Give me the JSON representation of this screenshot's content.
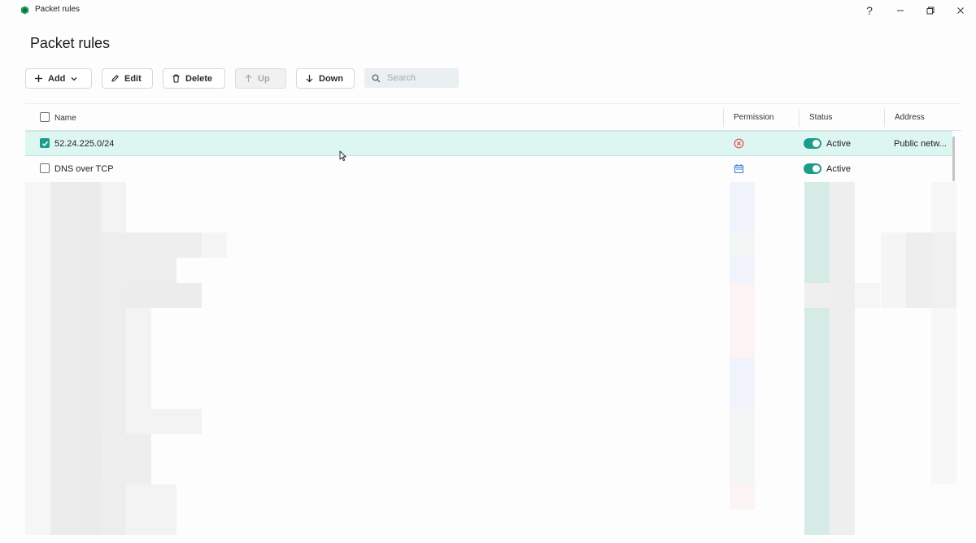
{
  "window": {
    "title": "Packet rules",
    "help": "?",
    "minimize": "–",
    "close": "✕"
  },
  "page": {
    "title": "Packet rules"
  },
  "toolbar": {
    "add_label": "Add",
    "edit_label": "Edit",
    "delete_label": "Delete",
    "up_label": "Up",
    "down_label": "Down",
    "search_placeholder": "Search"
  },
  "table": {
    "columns": {
      "name": "Name",
      "permission": "Permission",
      "status": "Status",
      "address": "Address"
    },
    "rows": [
      {
        "name": "52.24.225.0/24",
        "permission_icon": "block-icon",
        "status": "Active",
        "active": true,
        "address": "Public netw...",
        "selected": true
      },
      {
        "name": "DNS over TCP",
        "permission_icon": "calendar-icon",
        "status": "Active",
        "active": true,
        "address": "",
        "selected": false
      }
    ]
  },
  "colors": {
    "accent": "#1a9d8a",
    "selected_row": "#def6f1",
    "block_red": "#e14b4b",
    "calendar_blue": "#3d7fd6"
  }
}
